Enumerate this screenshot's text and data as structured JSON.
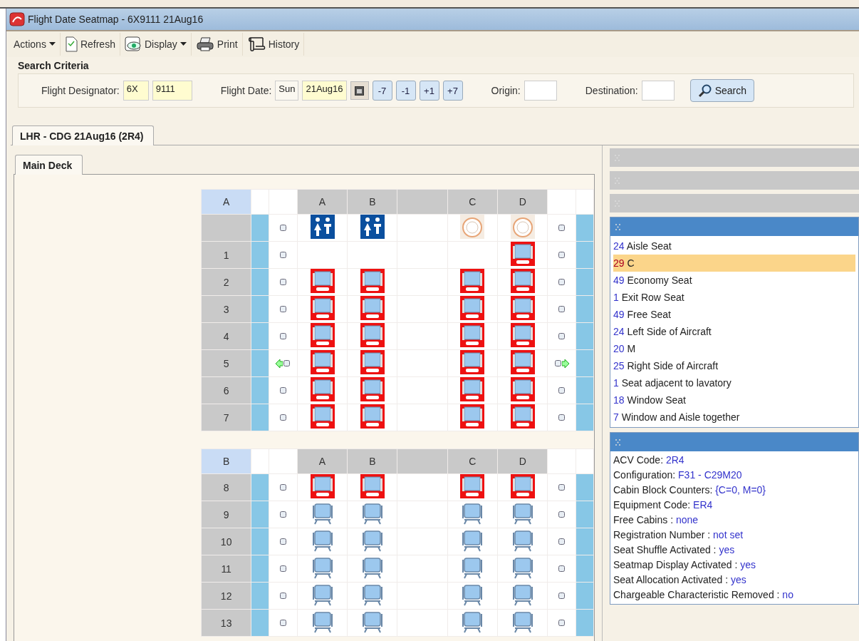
{
  "window": {
    "title": "Flight Date Seatmap - 6X9111  21Aug16"
  },
  "toolbar": [
    {
      "label": "Actions",
      "kind": "dropdown"
    },
    {
      "label": "Refresh",
      "kind": "button"
    },
    {
      "label": "Display",
      "kind": "dropdown"
    },
    {
      "label": "Print",
      "kind": "button"
    },
    {
      "label": "History",
      "kind": "button"
    }
  ],
  "search": {
    "title": "Search Criteria",
    "designator_label": "Flight Designator:",
    "airline": "6X",
    "flight_number": "9111",
    "date_label": "Flight Date:",
    "weekday": "Sun",
    "date": "21Aug16",
    "steps": [
      "-7",
      "-1",
      "+1",
      "+7"
    ],
    "origin_label": "Origin:",
    "destination_label": "Destination:",
    "search_button": "Search"
  },
  "route_tabs": [
    {
      "label": "LHR - CDG  21Aug16 (2R4)",
      "selected": true
    }
  ],
  "deck_tabs": [
    {
      "label": "Main Deck",
      "selected": true
    }
  ],
  "seatmap": {
    "blocks": [
      {
        "zone": "A",
        "columns": [
          "A",
          "B",
          "C",
          "D"
        ],
        "rows": [
          {
            "seats": [
              {
                "kind": "lavatory"
              },
              {
                "kind": "lavatory"
              },
              {
                "kind": "galley"
              },
              {
                "kind": "galley"
              }
            ],
            "exit": false
          },
          {
            "number": "1",
            "seats": [
              {
                "kind": "empty"
              },
              {
                "kind": "empty"
              },
              {
                "kind": "empty"
              },
              {
                "kind": "occupied"
              }
            ],
            "exit": false
          },
          {
            "number": "2",
            "seats": [
              {
                "kind": "occupied"
              },
              {
                "kind": "occupied"
              },
              {
                "kind": "occupied"
              },
              {
                "kind": "occupied"
              }
            ],
            "exit": false
          },
          {
            "number": "3",
            "seats": [
              {
                "kind": "occupied"
              },
              {
                "kind": "occupied"
              },
              {
                "kind": "occupied"
              },
              {
                "kind": "occupied"
              }
            ],
            "exit": false
          },
          {
            "number": "4",
            "seats": [
              {
                "kind": "occupied"
              },
              {
                "kind": "occupied"
              },
              {
                "kind": "occupied"
              },
              {
                "kind": "occupied"
              }
            ],
            "exit": false
          },
          {
            "number": "5",
            "seats": [
              {
                "kind": "occupied"
              },
              {
                "kind": "occupied"
              },
              {
                "kind": "occupied"
              },
              {
                "kind": "occupied"
              }
            ],
            "exit": true
          },
          {
            "number": "6",
            "seats": [
              {
                "kind": "occupied"
              },
              {
                "kind": "occupied"
              },
              {
                "kind": "occupied"
              },
              {
                "kind": "occupied"
              }
            ],
            "exit": false
          },
          {
            "number": "7",
            "seats": [
              {
                "kind": "occupied"
              },
              {
                "kind": "occupied"
              },
              {
                "kind": "occupied"
              },
              {
                "kind": "occupied"
              }
            ],
            "exit": false
          }
        ]
      },
      {
        "zone": "B",
        "columns": [
          "A",
          "B",
          "C",
          "D"
        ],
        "rows": [
          {
            "number": "8",
            "seats": [
              {
                "kind": "occupied"
              },
              {
                "kind": "occupied"
              },
              {
                "kind": "occupied"
              },
              {
                "kind": "occupied"
              }
            ],
            "exit": false
          },
          {
            "number": "9",
            "seats": [
              {
                "kind": "free"
              },
              {
                "kind": "free"
              },
              {
                "kind": "free"
              },
              {
                "kind": "free"
              }
            ],
            "exit": false
          },
          {
            "number": "10",
            "seats": [
              {
                "kind": "free"
              },
              {
                "kind": "free"
              },
              {
                "kind": "free"
              },
              {
                "kind": "free"
              }
            ],
            "exit": false
          },
          {
            "number": "11",
            "seats": [
              {
                "kind": "free"
              },
              {
                "kind": "free"
              },
              {
                "kind": "free"
              },
              {
                "kind": "free"
              }
            ],
            "exit": false
          },
          {
            "number": "12",
            "seats": [
              {
                "kind": "free"
              },
              {
                "kind": "free"
              },
              {
                "kind": "free"
              },
              {
                "kind": "free"
              }
            ],
            "exit": false
          },
          {
            "number": "13",
            "seats": [
              {
                "kind": "free"
              },
              {
                "kind": "free"
              },
              {
                "kind": "free"
              },
              {
                "kind": "free"
              }
            ],
            "exit": false
          }
        ]
      }
    ]
  },
  "side_panels": [
    {
      "expanded": false
    },
    {
      "expanded": false
    },
    {
      "expanded": false
    },
    {
      "expanded": true,
      "kind": "list",
      "items": [
        {
          "count": "24",
          "label": "Aisle Seat",
          "selected": false
        },
        {
          "count": "29",
          "label": "C",
          "selected": true
        },
        {
          "count": "49",
          "label": "Economy Seat",
          "selected": false
        },
        {
          "count": "1",
          "label": "Exit Row Seat",
          "selected": false
        },
        {
          "count": "49",
          "label": "Free Seat",
          "selected": false
        },
        {
          "count": "24",
          "label": "Left Side of Aircraft",
          "selected": false
        },
        {
          "count": "20",
          "label": "M",
          "selected": false
        },
        {
          "count": "25",
          "label": "Right Side of Aircraft",
          "selected": false
        },
        {
          "count": "1",
          "label": "Seat adjacent to lavatory",
          "selected": false
        },
        {
          "count": "18",
          "label": "Window Seat",
          "selected": false
        },
        {
          "count": "7",
          "label": "Window and Aisle together",
          "selected": false
        }
      ]
    },
    {
      "expanded": true,
      "kind": "info",
      "items": [
        {
          "label": "ACV Code:",
          "value": "2R4"
        },
        {
          "label": "Configuration:",
          "value": "F31 - C29M20"
        },
        {
          "label": "Cabin Block Counters:",
          "value": "{C=0, M=0}"
        },
        {
          "label": "Equipment Code:",
          "value": "ER4"
        },
        {
          "label": "Free Cabins :",
          "value": "none"
        },
        {
          "label": "Registration Number :",
          "value": "not set"
        },
        {
          "label": "Seat Shuffle Activated :",
          "value": "yes"
        },
        {
          "label": "Seatmap Display Activated :",
          "value": "yes"
        },
        {
          "label": "Seat Allocation Activated :",
          "value": "yes"
        },
        {
          "label": "Chargeable Characteristic Removed :",
          "value": "no"
        }
      ]
    }
  ]
}
